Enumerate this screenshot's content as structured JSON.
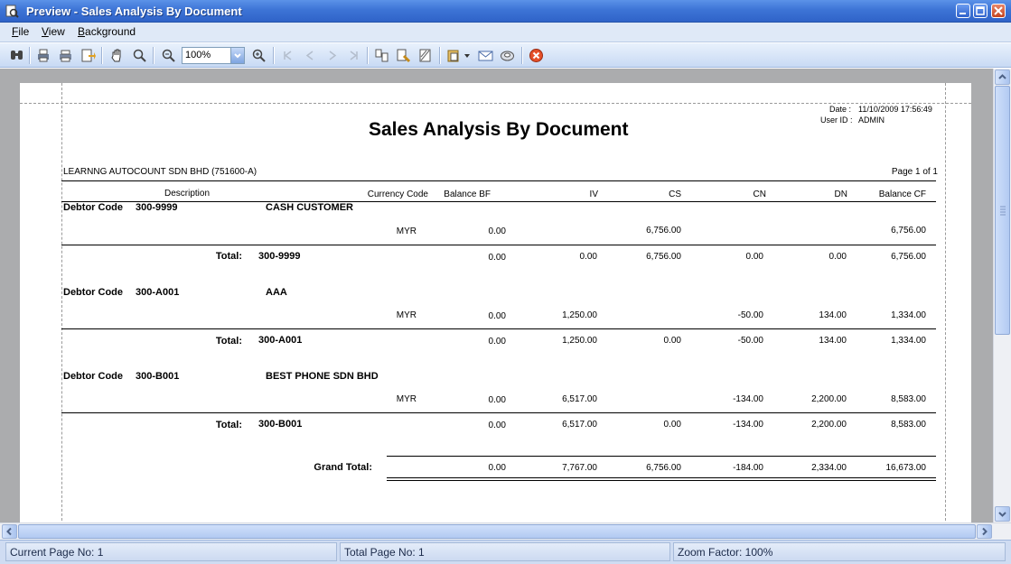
{
  "window": {
    "title": "Preview - Sales Analysis By Document"
  },
  "menu": [
    {
      "label": "File"
    },
    {
      "label": "View"
    },
    {
      "label": "Background"
    }
  ],
  "toolbar": {
    "zoom_value": "100%",
    "icons": [
      "find-icon",
      "print-setup-icon",
      "print-icon",
      "export-icon",
      "hand-tool-icon",
      "magnifier-icon",
      "zoom-out-icon",
      "zoom-in-icon",
      "first-page-icon",
      "prev-page-icon",
      "next-page-icon",
      "last-page-icon",
      "multi-page-icon",
      "page-setup-icon",
      "watermark-icon",
      "open-icon",
      "email-icon",
      "save-icon",
      "close-preview-icon"
    ]
  },
  "report": {
    "date_label": "Date :",
    "date_value": "11/10/2009 17:56:49",
    "user_label": "User ID :",
    "user_value": "ADMIN",
    "title": "Sales Analysis By Document",
    "company": "LEARNNG AUTOCOUNT SDN BHD (751600-A)",
    "page": "Page 1 of 1",
    "columns": {
      "description": "Description",
      "currency": "Currency Code",
      "balance_bf": "Balance BF",
      "iv": "IV",
      "cs": "CS",
      "cn": "CN",
      "dn": "DN",
      "balance_cf": "Balance CF"
    },
    "debtor_label": "Debtor Code",
    "total_label": "Total:",
    "groups": [
      {
        "code": "300-9999",
        "name": "CASH CUSTOMER",
        "detail": {
          "currency": "MYR",
          "bf": "0.00",
          "iv": "",
          "cs": "6,756.00",
          "cn": "",
          "dn": "",
          "cf": "6,756.00"
        },
        "total": {
          "bf": "0.00",
          "iv": "0.00",
          "cs": "6,756.00",
          "cn": "0.00",
          "dn": "0.00",
          "cf": "6,756.00"
        }
      },
      {
        "code": "300-A001",
        "name": "AAA",
        "detail": {
          "currency": "MYR",
          "bf": "0.00",
          "iv": "1,250.00",
          "cs": "",
          "cn": "-50.00",
          "dn": "134.00",
          "cf": "1,334.00"
        },
        "total": {
          "bf": "0.00",
          "iv": "1,250.00",
          "cs": "0.00",
          "cn": "-50.00",
          "dn": "134.00",
          "cf": "1,334.00"
        }
      },
      {
        "code": "300-B001",
        "name": "BEST PHONE SDN BHD",
        "detail": {
          "currency": "MYR",
          "bf": "0.00",
          "iv": "6,517.00",
          "cs": "",
          "cn": "-134.00",
          "dn": "2,200.00",
          "cf": "8,583.00"
        },
        "total": {
          "bf": "0.00",
          "iv": "6,517.00",
          "cs": "0.00",
          "cn": "-134.00",
          "dn": "2,200.00",
          "cf": "8,583.00"
        }
      }
    ],
    "grand_total": {
      "label": "Grand Total:",
      "bf": "0.00",
      "iv": "7,767.00",
      "cs": "6,756.00",
      "cn": "-184.00",
      "dn": "2,334.00",
      "cf": "16,673.00"
    }
  },
  "status": {
    "current_page": "Current Page No: 1",
    "total_page": "Total Page No: 1",
    "zoom": "Zoom Factor: 100%"
  }
}
